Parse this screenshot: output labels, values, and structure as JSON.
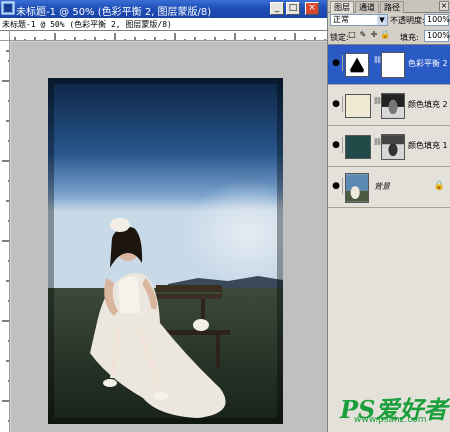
{
  "window": {
    "title": "未标题-1 @ 50% (色彩平衡 2, 图层蒙版/8)",
    "subtitle": "未标题-1 @ 50% (色彩平衡 2, 图层蒙版/8)",
    "buttons": {
      "minimize": "_",
      "maximize": "□",
      "close": "×"
    }
  },
  "panel": {
    "tabs": [
      "图层",
      "通道",
      "路径"
    ],
    "active_tab": "图层",
    "close": "×",
    "blend_mode": "正常",
    "opacity_label": "不透明度:",
    "opacity_value": "100%",
    "lock_label": "锁定:",
    "fill_label": "填充:",
    "fill_value": "100%",
    "layers": [
      {
        "name": "色彩平衡 2",
        "selected": true,
        "visible": true,
        "type": "adjustment",
        "icon": "color-balance-icon"
      },
      {
        "name": "颜色填充 2",
        "selected": false,
        "visible": true,
        "type": "fill",
        "swatch": "#efe9d2"
      },
      {
        "name": "颜色填充 1",
        "selected": false,
        "visible": true,
        "type": "fill",
        "swatch": "#1f4a48"
      },
      {
        "name": "背景",
        "selected": false,
        "visible": true,
        "type": "background",
        "locked": true
      }
    ]
  },
  "watermark": {
    "main": "PS爱好者",
    "url": "www.psahz.com"
  },
  "colors": {
    "title_blue": "#1f4fb8",
    "selected_layer": "#2a5bc5",
    "watermark_green": "#1a9f3a"
  }
}
